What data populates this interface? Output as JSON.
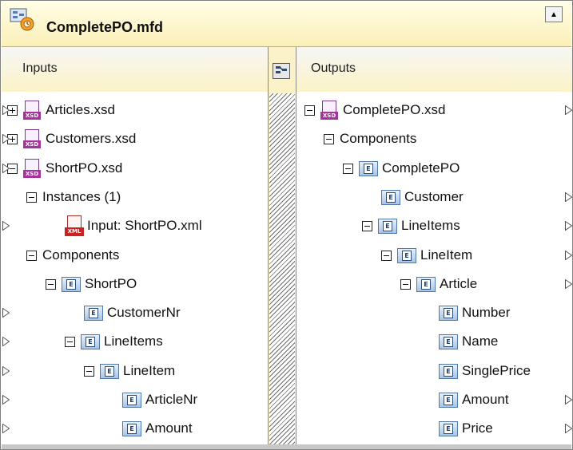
{
  "title": "CompletePO.mfd",
  "inputs_header": "Inputs",
  "outputs_header": "Outputs",
  "input_tree": [
    {
      "label": "Articles.xsd",
      "icon": "xsd-file-icon",
      "expander": "plus",
      "indent": 0,
      "connector": true
    },
    {
      "label": "Customers.xsd",
      "icon": "xsd-file-icon",
      "expander": "plus",
      "indent": 0,
      "connector": true
    },
    {
      "label": "ShortPO.xsd",
      "icon": "xsd-file-icon",
      "expander": "minus",
      "indent": 0,
      "connector": true
    },
    {
      "label": "Instances (1)",
      "icon": "",
      "expander": "minus",
      "indent": 1,
      "connector": false
    },
    {
      "label": "Input: ShortPO.xml",
      "icon": "xml-file-icon",
      "expander": "",
      "indent": 3,
      "connector": true
    },
    {
      "label": "Components",
      "icon": "",
      "expander": "minus",
      "indent": 1,
      "connector": false
    },
    {
      "label": "ShortPO",
      "icon": "element-icon",
      "expander": "minus",
      "indent": 2,
      "connector": false
    },
    {
      "label": "CustomerNr",
      "icon": "element-icon",
      "expander": "",
      "indent": 4,
      "connector": true
    },
    {
      "label": "LineItems",
      "icon": "element-icon",
      "expander": "minus",
      "indent": 3,
      "connector": true
    },
    {
      "label": "LineItem",
      "icon": "element-icon",
      "expander": "minus",
      "indent": 4,
      "connector": true
    },
    {
      "label": "ArticleNr",
      "icon": "element-icon",
      "expander": "",
      "indent": 6,
      "connector": true
    },
    {
      "label": "Amount",
      "icon": "element-icon",
      "expander": "",
      "indent": 6,
      "connector": true
    }
  ],
  "output_tree": [
    {
      "label": "CompletePO.xsd",
      "icon": "xsd-file-icon",
      "expander": "minus",
      "indent": 0,
      "connector": true
    },
    {
      "label": "Components",
      "icon": "",
      "expander": "minus",
      "indent": 1,
      "connector": false
    },
    {
      "label": "CompletePO",
      "icon": "element-icon",
      "expander": "minus",
      "indent": 2,
      "connector": false
    },
    {
      "label": "Customer",
      "icon": "element-icon",
      "expander": "",
      "indent": 4,
      "connector": true
    },
    {
      "label": "LineItems",
      "icon": "element-icon",
      "expander": "minus",
      "indent": 3,
      "connector": true
    },
    {
      "label": "LineItem",
      "icon": "element-icon",
      "expander": "minus",
      "indent": 4,
      "connector": true
    },
    {
      "label": "Article",
      "icon": "element-icon",
      "expander": "minus",
      "indent": 5,
      "connector": true
    },
    {
      "label": "Number",
      "icon": "element-icon",
      "expander": "",
      "indent": 7,
      "connector": false
    },
    {
      "label": "Name",
      "icon": "element-icon",
      "expander": "",
      "indent": 7,
      "connector": false
    },
    {
      "label": "SinglePrice",
      "icon": "element-icon",
      "expander": "",
      "indent": 7,
      "connector": false
    },
    {
      "label": "Amount",
      "icon": "element-icon",
      "expander": "",
      "indent": 7,
      "connector": true
    },
    {
      "label": "Price",
      "icon": "element-icon",
      "expander": "",
      "indent": 7,
      "connector": true
    }
  ]
}
